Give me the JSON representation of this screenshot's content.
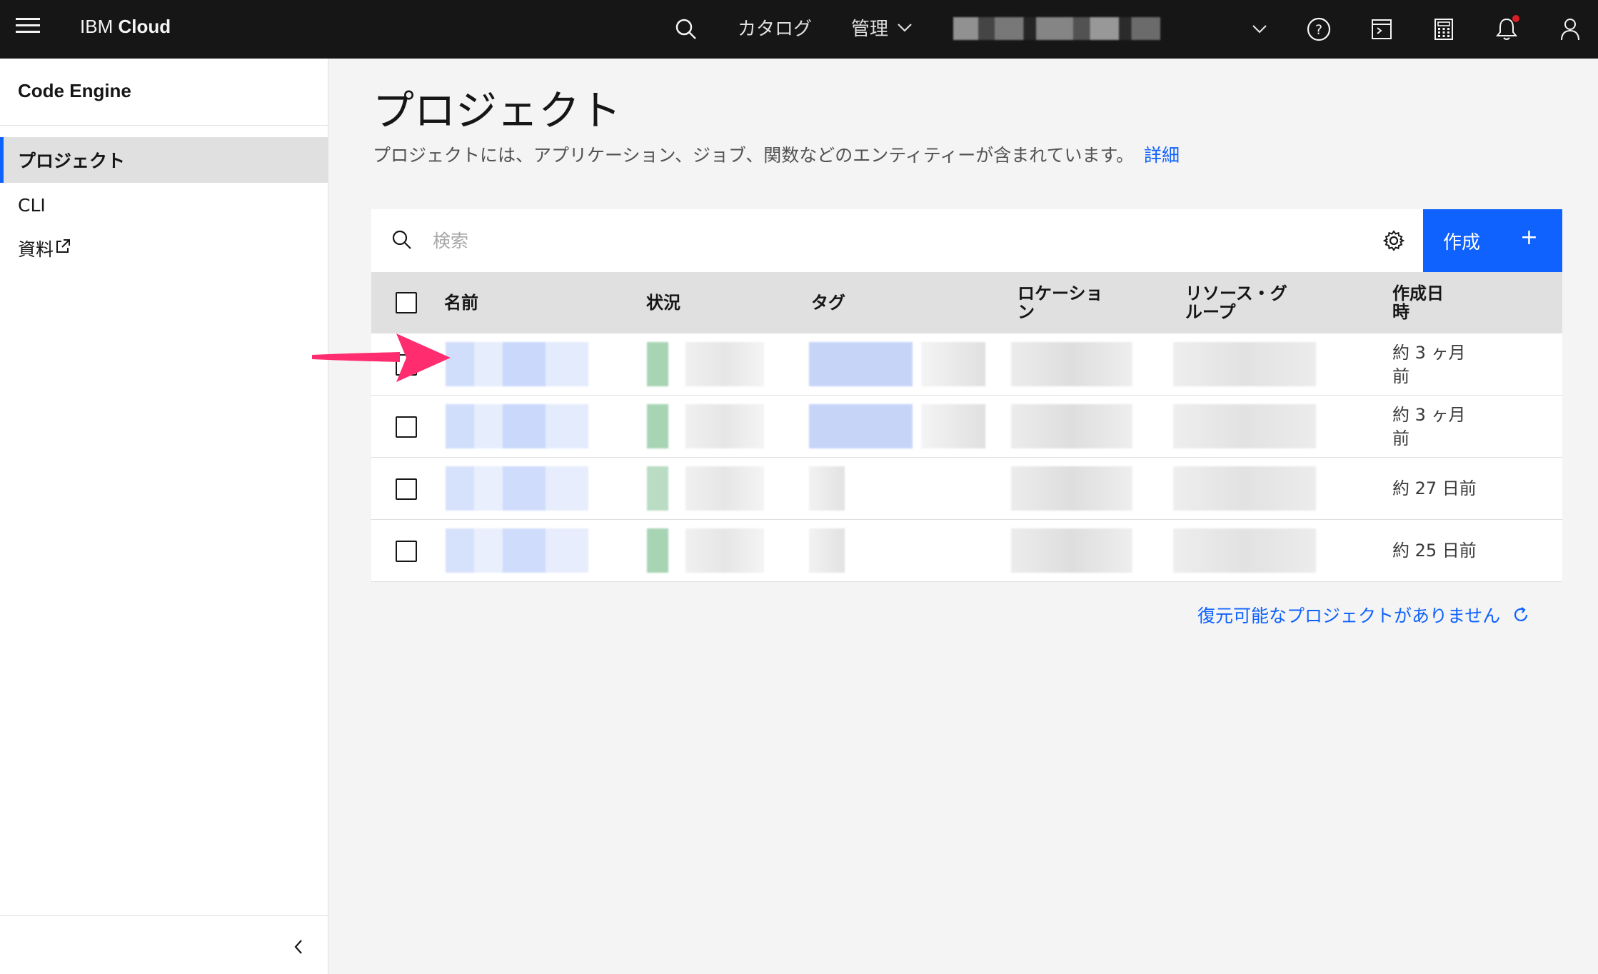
{
  "header": {
    "brand_prefix": "IBM",
    "brand_suffix": "Cloud",
    "nav_catalog": "カタログ",
    "nav_manage": "管理",
    "icons": [
      "menu-icon",
      "search-icon",
      "chevron-down-icon",
      "help-icon",
      "cloud-shell-icon",
      "cost-estimator-icon",
      "notification-icon",
      "user-icon"
    ]
  },
  "sidebar": {
    "title": "Code Engine",
    "items": [
      {
        "label": "プロジェクト",
        "active": true
      },
      {
        "label": "CLI",
        "active": false
      },
      {
        "label": "資料",
        "active": false,
        "external": true
      }
    ]
  },
  "main": {
    "title": "プロジェクト",
    "description": "プロジェクトには、アプリケーション、ジョブ、関数などのエンティティーが含まれています。",
    "details_link": "詳細",
    "search_placeholder": "検索",
    "create_label": "作成",
    "create_icon": "+",
    "columns": [
      "名前",
      "状況",
      "タグ",
      "ロケーショ\nン",
      "リソース・グ\nループ",
      "作成日\n時"
    ],
    "rows": [
      {
        "created": "約 3 ヶ月\n前"
      },
      {
        "created": "約 3 ヶ月\n前"
      },
      {
        "created": "約 27 日前"
      },
      {
        "created": "約 25 日前"
      }
    ],
    "restore_text": "復元可能なプロジェクトがありません"
  },
  "colors": {
    "header_bg": "#161616",
    "primary": "#0f62fe",
    "arrow": "#ff2d6f",
    "status_green": "#a7d4b3"
  }
}
